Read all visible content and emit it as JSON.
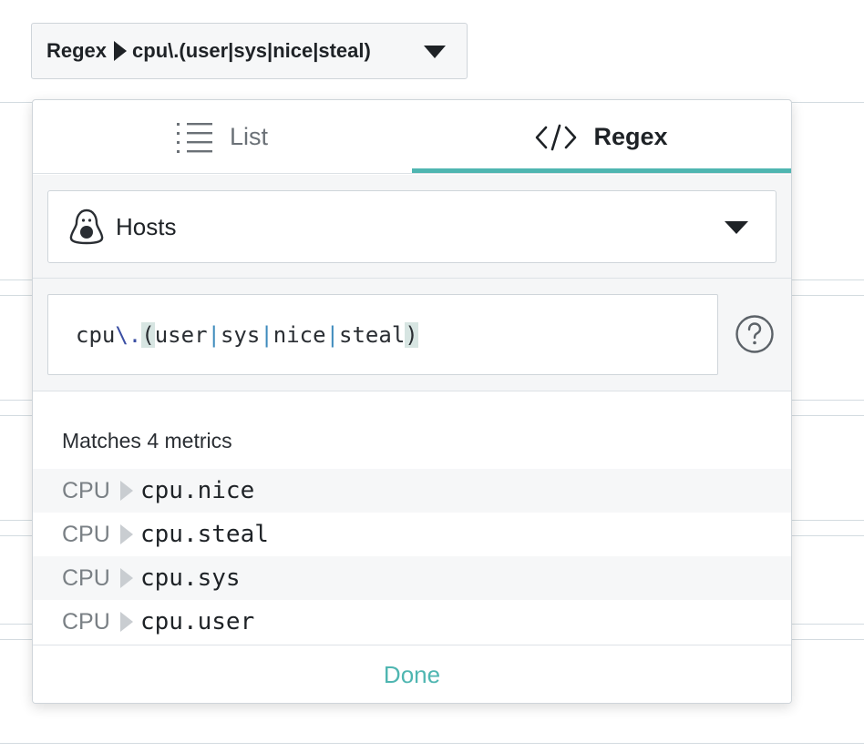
{
  "trigger": {
    "mode": "Regex",
    "pattern": "cpu\\.(user|sys|nice|steal)"
  },
  "tabs": [
    {
      "label": "List",
      "icon": "list-icon",
      "active": false
    },
    {
      "label": "Regex",
      "icon": "code-icon",
      "active": true
    }
  ],
  "scope": {
    "label": "Hosts",
    "icon": "penguin-icon"
  },
  "regex_input": {
    "prefix": "cpu",
    "escape": "\\.",
    "open": "(",
    "alt1": "user",
    "alt2": "sys",
    "alt3": "nice",
    "alt4": "steal",
    "close": ")",
    "pipe": "|"
  },
  "results": {
    "title": "Matches 4 metrics",
    "items": [
      {
        "category": "CPU",
        "metric": "cpu.nice"
      },
      {
        "category": "CPU",
        "metric": "cpu.steal"
      },
      {
        "category": "CPU",
        "metric": "cpu.sys"
      },
      {
        "category": "CPU",
        "metric": "cpu.user"
      }
    ]
  },
  "footer": {
    "done_label": "Done"
  },
  "colors": {
    "accent": "#4fb6b1",
    "text": "#1e2226",
    "muted": "#7a8085"
  }
}
